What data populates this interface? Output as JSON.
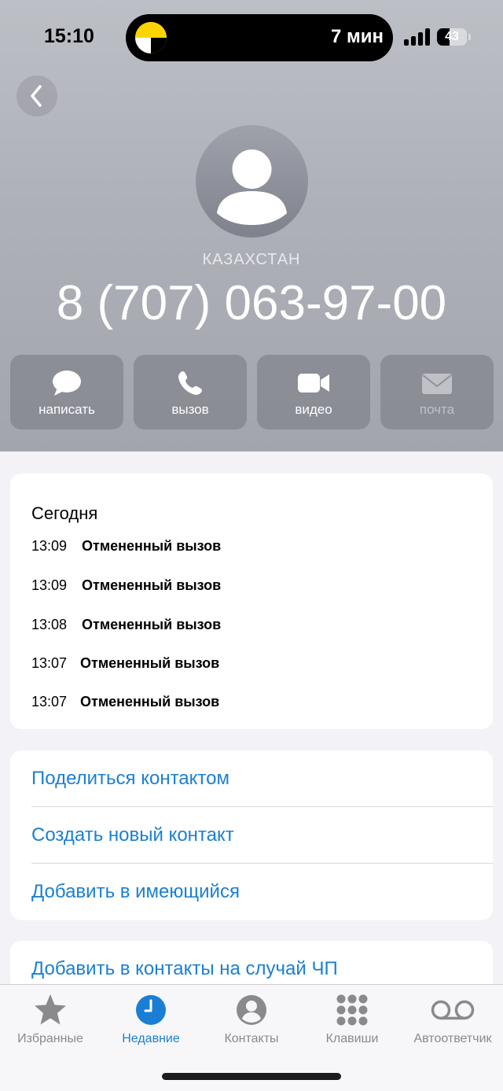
{
  "status_bar": {
    "time": "15:10",
    "island_text": "7 мин",
    "battery": "43",
    "battery_fraction": 0.43
  },
  "contact": {
    "country": "КАЗАХСТАН",
    "phone": "8 (707) 063-97-00"
  },
  "actions": [
    {
      "label": "написать",
      "icon": "message-icon",
      "enabled": true
    },
    {
      "label": "вызов",
      "icon": "phone-icon",
      "enabled": true
    },
    {
      "label": "видео",
      "icon": "video-icon",
      "enabled": true
    },
    {
      "label": "почта",
      "icon": "mail-icon",
      "enabled": false
    }
  ],
  "history": {
    "title": "Сегодня",
    "rows": [
      {
        "time": "13:09",
        "desc": "Отмененный вызов"
      },
      {
        "time": "13:09",
        "desc": "Отмененный вызов"
      },
      {
        "time": "13:08",
        "desc": "Отмененный вызов"
      },
      {
        "time": "13:07",
        "desc": "Отмененный вызов"
      },
      {
        "time": "13:07",
        "desc": "Отмененный вызов"
      }
    ]
  },
  "links": [
    "Поделиться контактом",
    "Создать новый контакт",
    "Добавить в имеющийся"
  ],
  "emergency_link": "Добавить в контакты на случай ЧП",
  "tabs": [
    {
      "label": "Избранные",
      "icon": "star-icon",
      "active": false
    },
    {
      "label": "Недавние",
      "icon": "clock-icon",
      "active": true
    },
    {
      "label": "Контакты",
      "icon": "person-circle-icon",
      "active": false
    },
    {
      "label": "Клавиши",
      "icon": "keypad-icon",
      "active": false
    },
    {
      "label": "Автоответчик",
      "icon": "voicemail-icon",
      "active": false
    }
  ],
  "colors": {
    "accent": "#1a7fd4",
    "header_gray": "#afb1b9",
    "tab_inactive": "#8a8a8e"
  }
}
